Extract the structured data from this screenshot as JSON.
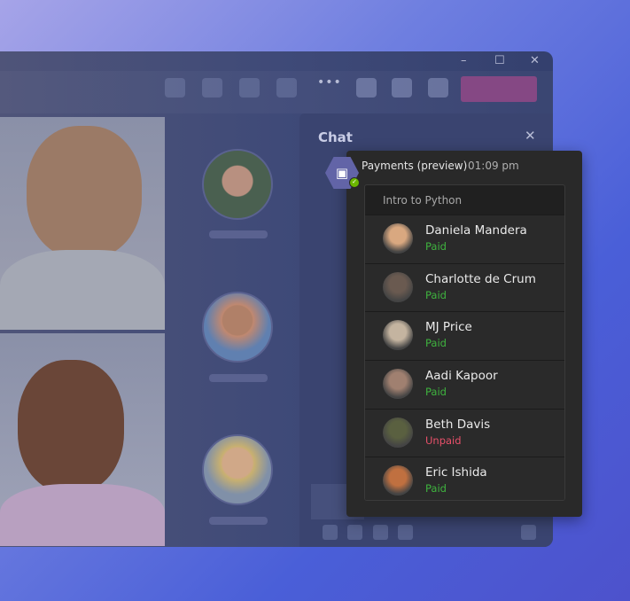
{
  "window": {
    "controls": [
      "–",
      "☐",
      "✕"
    ],
    "more_label": "•••"
  },
  "chat": {
    "title": "Chat",
    "close": "✕"
  },
  "message": {
    "sender": "Payments (preview)",
    "time": "01:09 pm",
    "app_icon": "money-icon",
    "card": {
      "title": "Intro to Python",
      "students": [
        {
          "name": "Daniela Mandera",
          "status": "Paid",
          "avatar": "#d9a880"
        },
        {
          "name": "Charlotte de Crum",
          "status": "Paid",
          "avatar": "#6a5a50"
        },
        {
          "name": "MJ Price",
          "status": "Paid",
          "avatar": "#c4b4a0"
        },
        {
          "name": "Aadi Kapoor",
          "status": "Paid",
          "avatar": "#a08070"
        },
        {
          "name": "Beth Davis",
          "status": "Unpaid",
          "avatar": "#5a6040"
        },
        {
          "name": "Eric Ishida",
          "status": "Paid",
          "avatar": "#c07040"
        }
      ]
    }
  },
  "colors": {
    "paid": "#3fb33f",
    "unpaid": "#e8506a",
    "accent": "#854884"
  }
}
